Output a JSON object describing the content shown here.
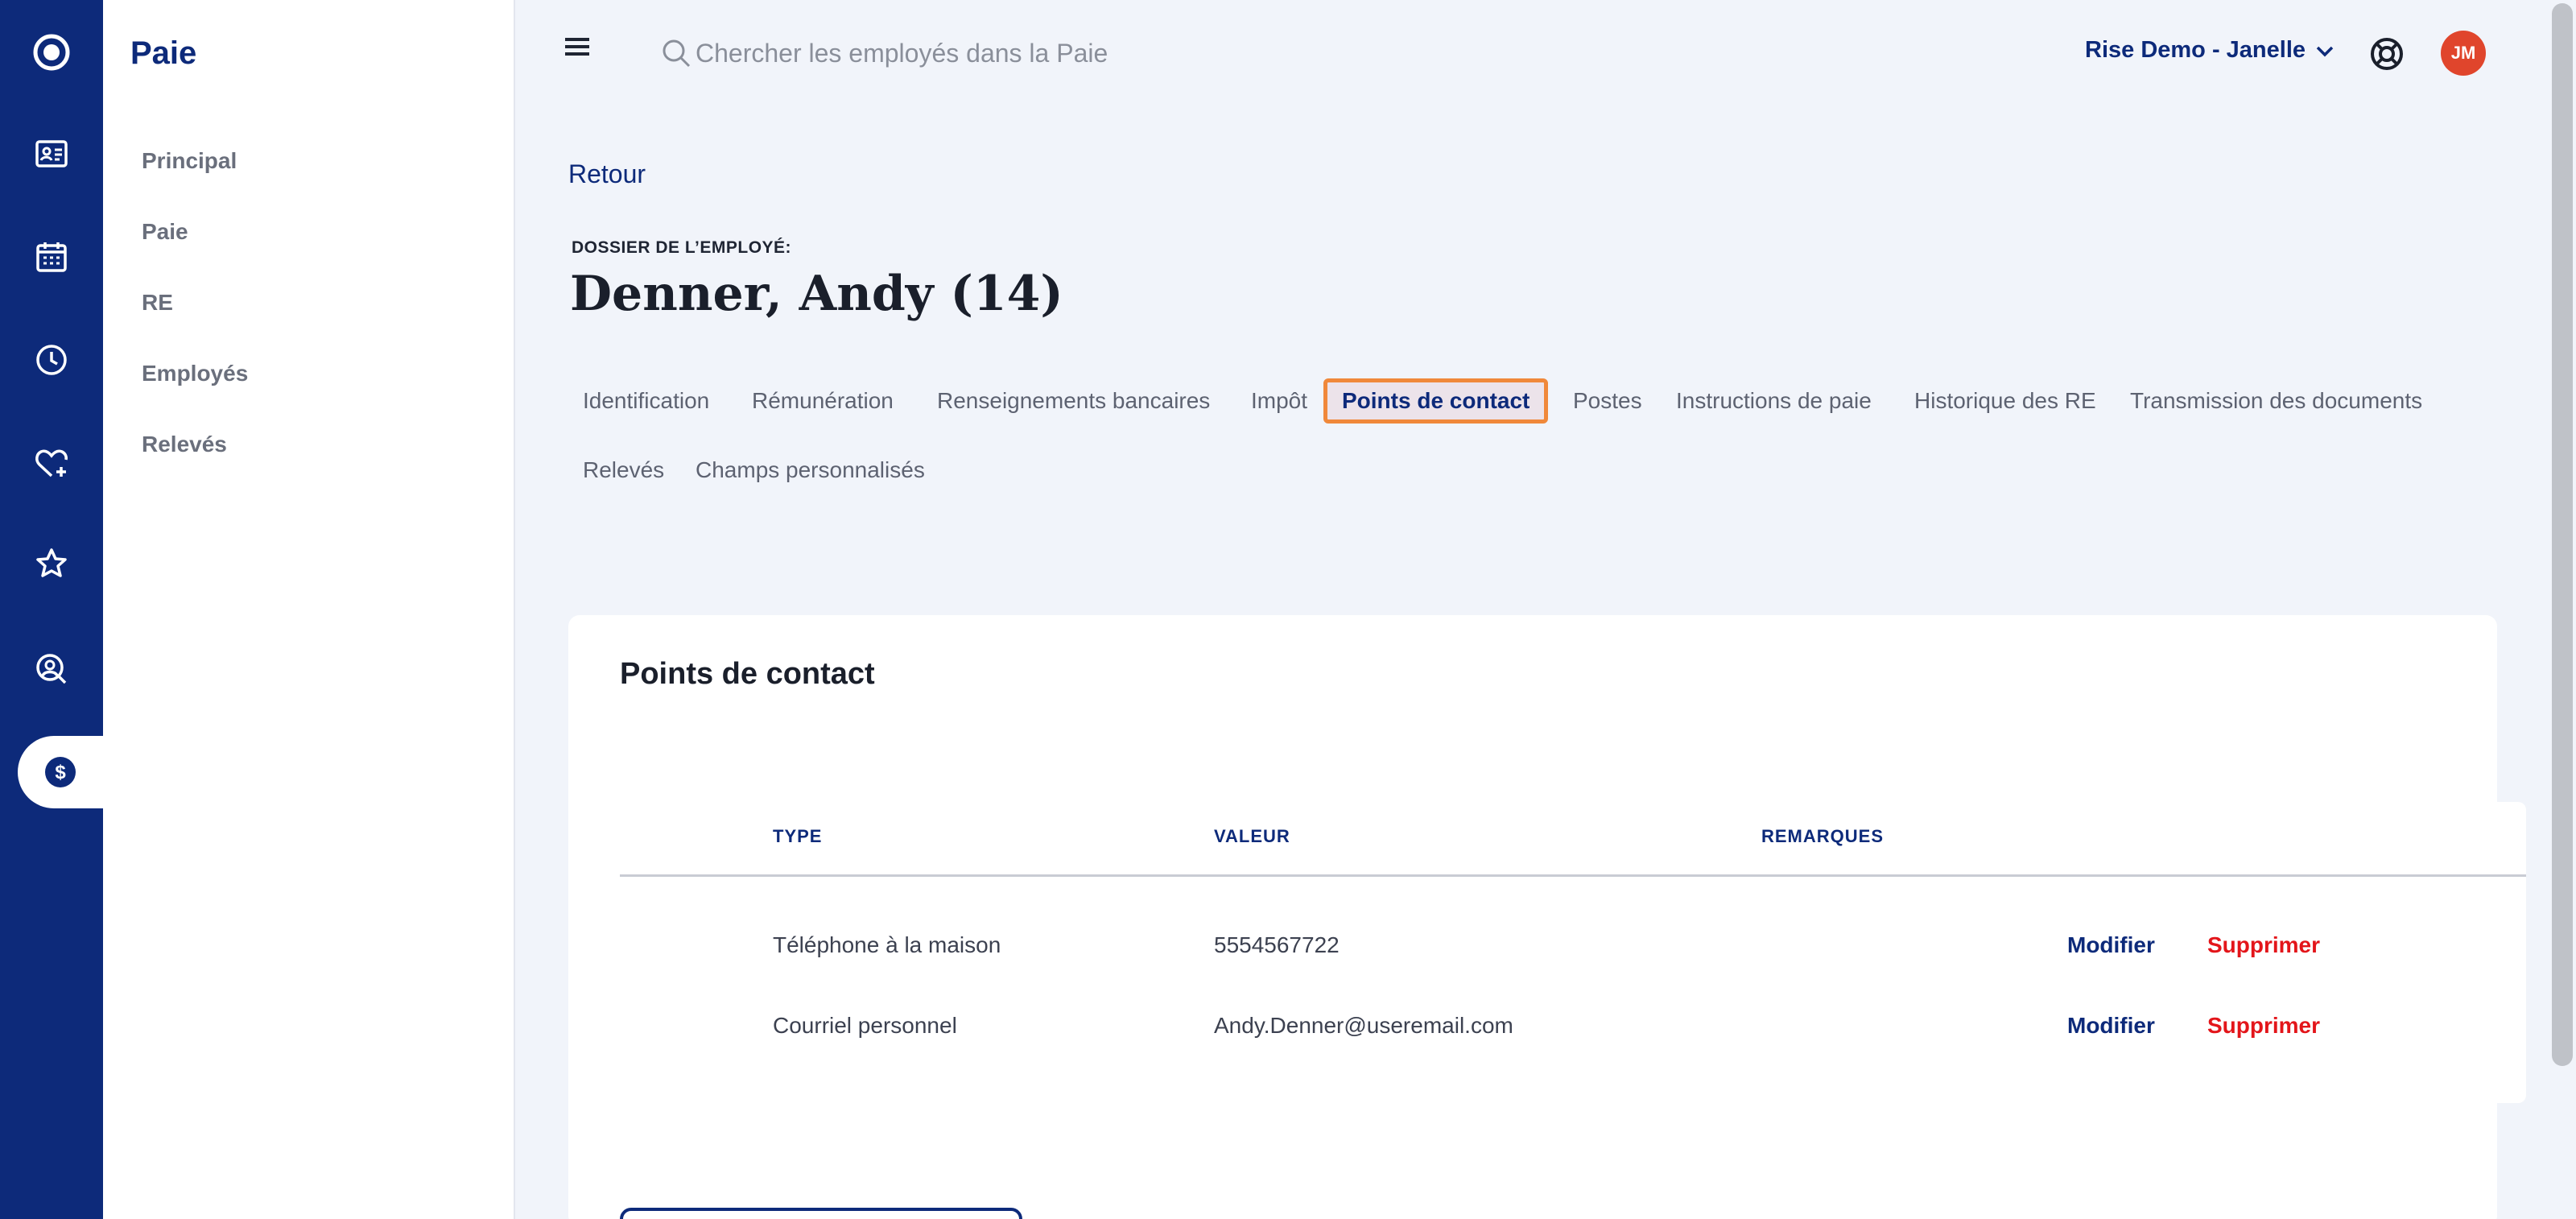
{
  "rail": {
    "items": [
      {
        "icon": "logo-circle-icon"
      },
      {
        "icon": "id-card-icon"
      },
      {
        "icon": "calendar-icon"
      },
      {
        "icon": "clock-icon"
      },
      {
        "icon": "heart-plus-icon"
      },
      {
        "icon": "star-icon"
      },
      {
        "icon": "user-search-icon"
      },
      {
        "icon": "dollar-icon",
        "active": true
      }
    ],
    "colors": {
      "background": "#0d2a7a",
      "active": "#ffffff"
    }
  },
  "sidebar": {
    "title": "Paie",
    "items": [
      {
        "label": "Principal"
      },
      {
        "label": "Paie"
      },
      {
        "label": "RE"
      },
      {
        "label": "Employés"
      },
      {
        "label": "Relevés"
      }
    ]
  },
  "topbar": {
    "menu_icon": "hamburger-menu-icon",
    "search_placeholder": "Chercher les employés dans la Paie",
    "company": "Rise Demo - Janelle",
    "help_icon": "lifebuoy-icon",
    "avatar_initials": "JM",
    "avatar_color": "#e0452c"
  },
  "page": {
    "back": "Retour",
    "eyebrow": "DOSSIER DE L’EMPLOYÉ:",
    "employee_name": "Denner, Andy (14)"
  },
  "tabs": [
    {
      "label": "Identification"
    },
    {
      "label": "Rémunération"
    },
    {
      "label": "Renseignements bancaires"
    },
    {
      "label": "Impôt"
    },
    {
      "label": "Points de contact",
      "active": true
    },
    {
      "label": "Postes"
    },
    {
      "label": "Instructions de paie"
    },
    {
      "label": "Historique des RE"
    },
    {
      "label": "Transmission des documents"
    },
    {
      "label": "Relevés"
    },
    {
      "label": "Champs personnalisés"
    }
  ],
  "contacts": {
    "title": "Points de contact",
    "columns": [
      "TYPE",
      "VALEUR",
      "REMARQUES"
    ],
    "rows": [
      {
        "type": "Téléphone à la maison",
        "value": "5554567722",
        "remarks": "",
        "edit": "Modifier",
        "delete": "Supprimer"
      },
      {
        "type": "Courriel personnel",
        "value": "Andy.Denner@useremail.com",
        "remarks": "",
        "edit": "Modifier",
        "delete": "Supprimer"
      }
    ]
  },
  "accent_colors": {
    "primary": "#0d2a7a",
    "danger": "#e3151a",
    "highlight": "#f0883a"
  }
}
